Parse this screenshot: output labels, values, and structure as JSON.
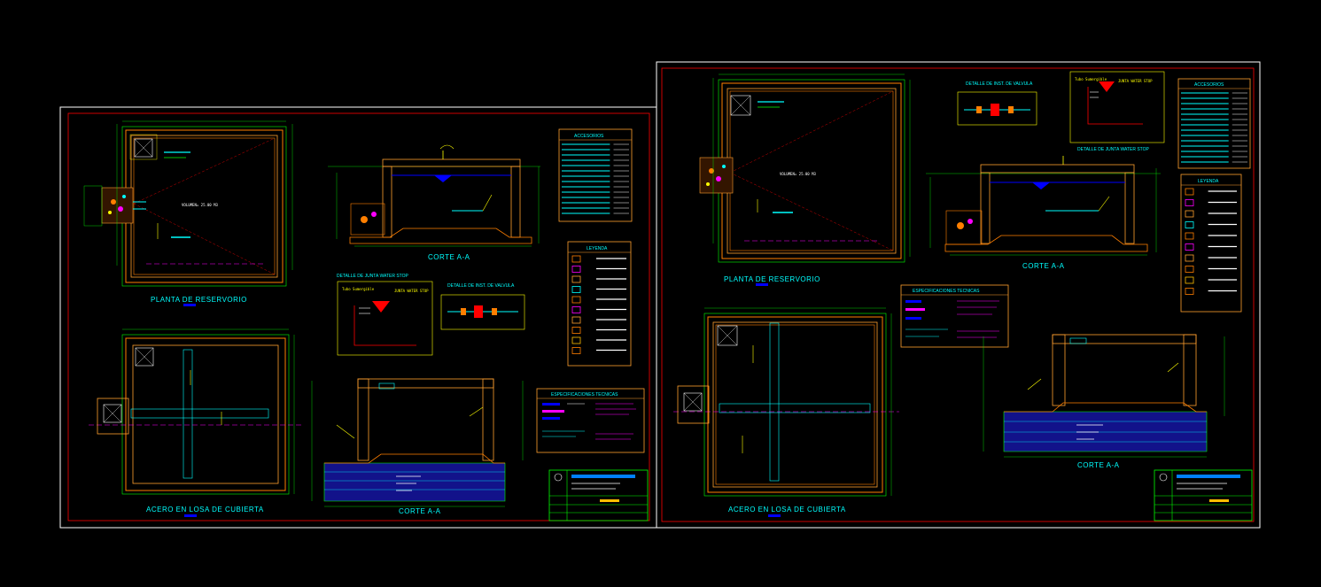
{
  "sheet_left": {
    "planta_title": "PLANTA DE RESERVORIO",
    "volumen_note": "VOLUMEN= 25.00 M3",
    "corte_top_title": "CORTE A-A",
    "detalle_junta_title": "DETALLE DE JUNTA WATER STOP",
    "detalle_valvula_title": "DETALLE DE INST. DE VALVULA",
    "accesorios_title": "ACCESORIOS",
    "leyenda_title": "LEYENDA",
    "especificaciones_title": "ESPECIFICACIONES TECNICAS",
    "acero_title": "ACERO EN LOSA DE CUBIERTA",
    "corte_bottom_title": "CORTE A-A",
    "junta_label": "Tubo Sumergible",
    "junta_note": "JUNTA WATER STOP"
  },
  "sheet_right": {
    "planta_title": "PLANTA DE RESERVORIO",
    "volumen_note": "VOLUMEN= 25.00 M3",
    "corte_top_title": "CORTE A-A",
    "detalle_junta_title": "DETALLE DE JUNTA WATER STOP",
    "detalle_valvula_title": "DETALLE DE INST. DE VALVULA",
    "accesorios_title": "ACCESORIOS",
    "leyenda_title": "LEYENDA",
    "especificaciones_title": "ESPECIFICACIONES TECNICAS",
    "acero_title": "ACERO EN LOSA DE CUBIERTA",
    "corte_bottom_title": "CORTE A-A",
    "junta_label": "Tubo Sumergible",
    "junta_note": "JUNTA WATER STOP"
  },
  "colors": {
    "background": "#000000",
    "sheet_border": "#ffffff",
    "inner_border": "#ff0000",
    "wall_outer": "#ff7f00",
    "wall_inner": "#ff9f2f",
    "dimension": "#00ff00",
    "text": "#00ffff",
    "accent_yellow": "#ffff00",
    "accent_magenta": "#ff00ff",
    "water": "#0000ff",
    "concrete": "#2020ff"
  }
}
